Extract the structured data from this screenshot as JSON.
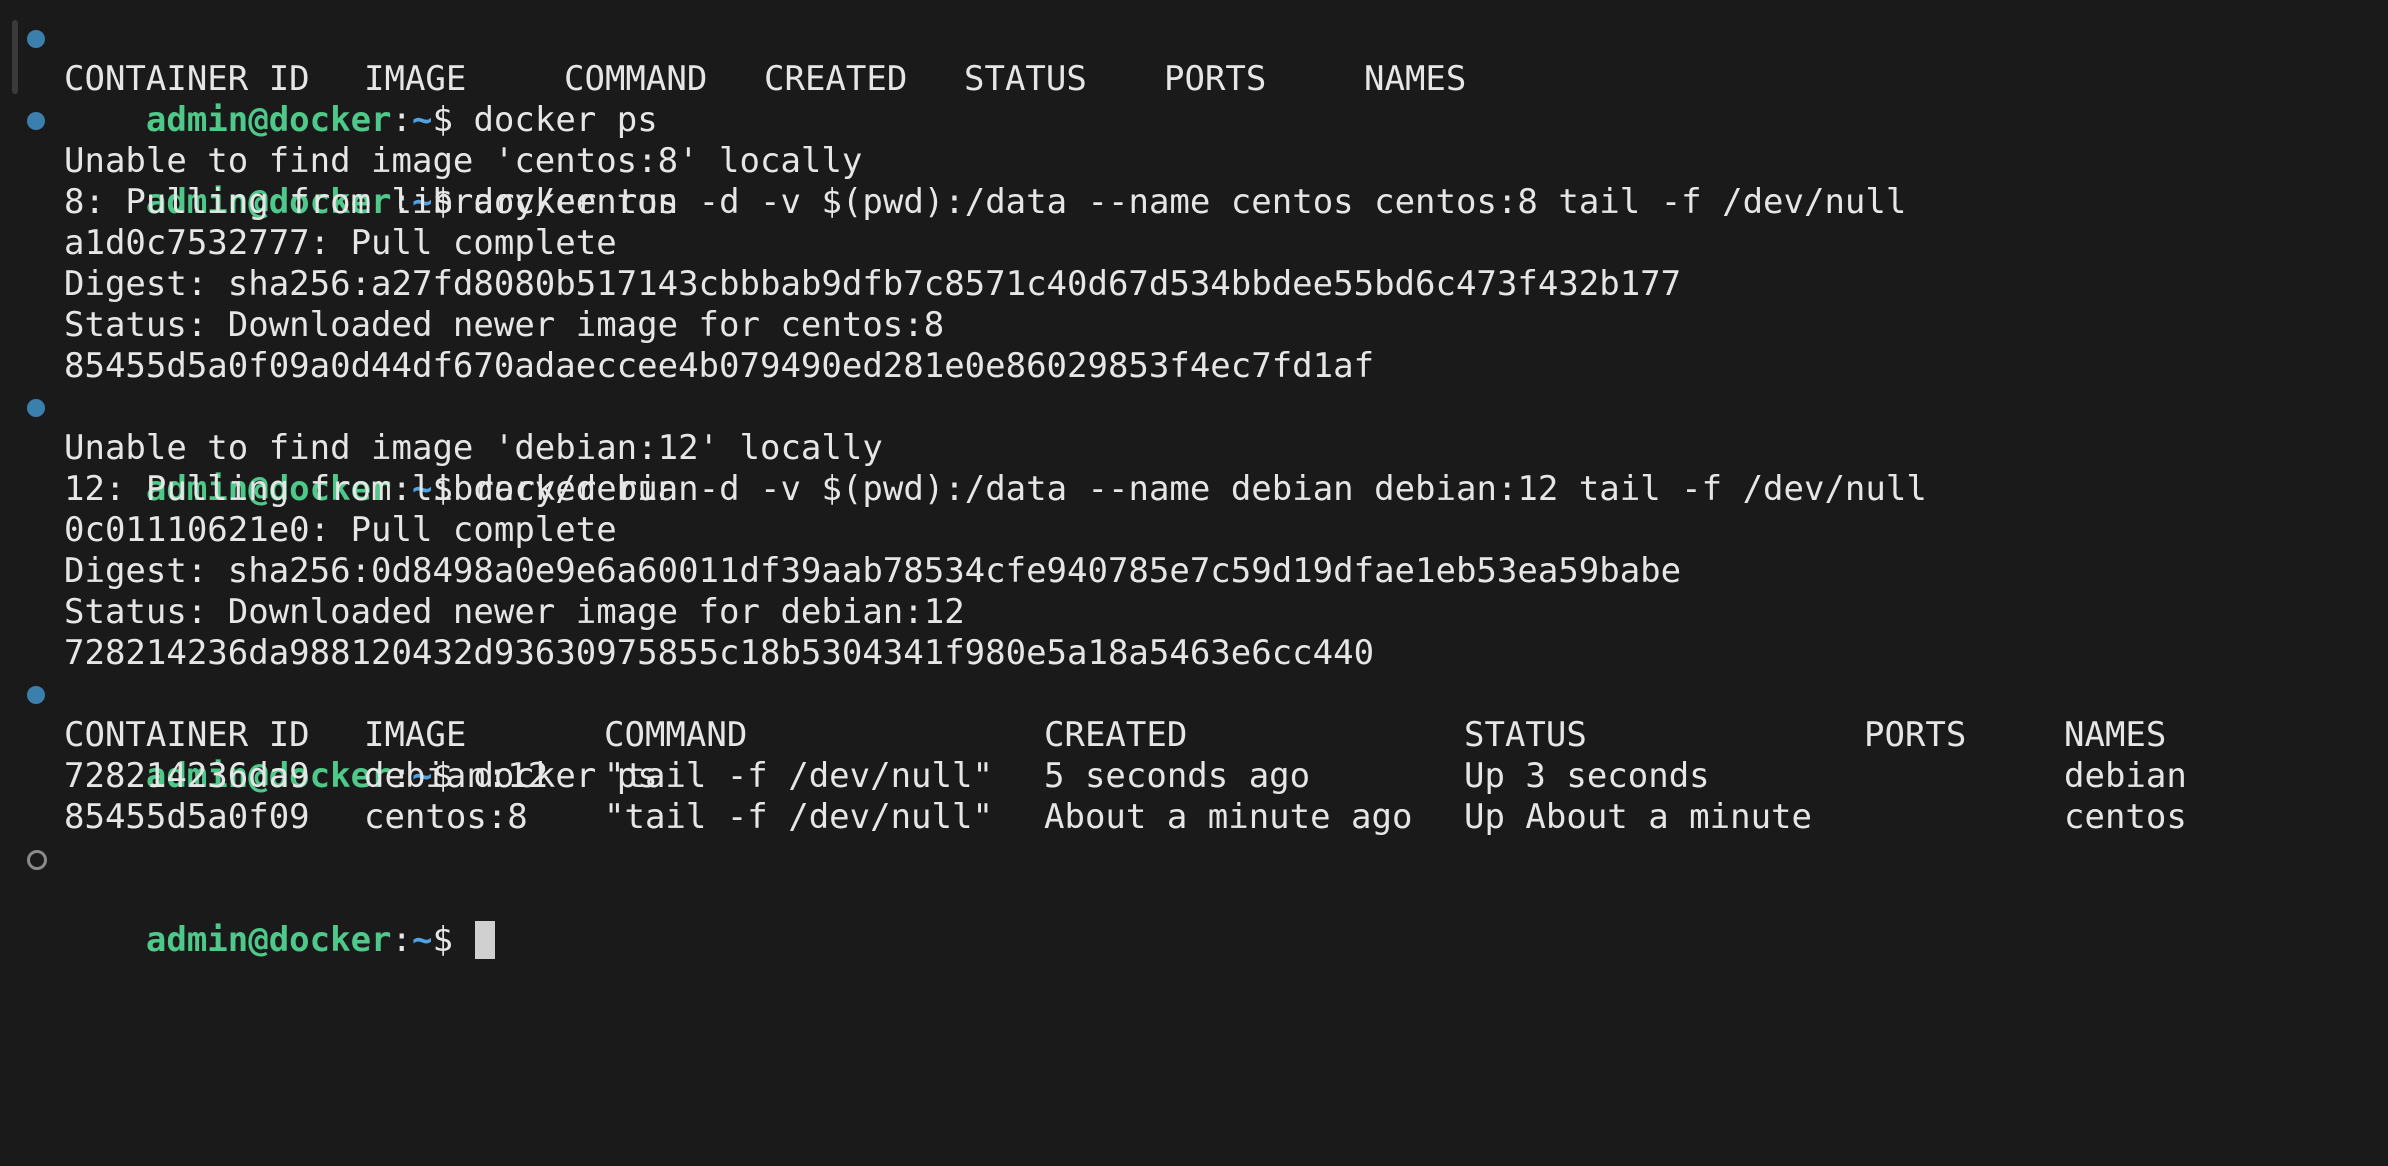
{
  "prompt": {
    "user_host": "admin@docker",
    "sep": ":",
    "path": "~",
    "symbol": "$ "
  },
  "commands": {
    "ps1": "docker ps",
    "run_centos": "docker run -d -v $(pwd):/data --name centos centos:8 tail -f /dev/null",
    "run_debian": "docker run -d -v $(pwd):/data --name debian debian:12 tail -f /dev/null",
    "ps2": "docker ps"
  },
  "ps1_header": {
    "container_id": "CONTAINER ID",
    "image": "IMAGE",
    "command": "COMMAND",
    "created": "CREATED",
    "status": "STATUS",
    "ports": "PORTS",
    "names": "NAMES"
  },
  "centos_output": [
    "Unable to find image 'centos:8' locally",
    "8: Pulling from library/centos",
    "a1d0c7532777: Pull complete",
    "Digest: sha256:a27fd8080b517143cbbbab9dfb7c8571c40d67d534bbdee55bd6c473f432b177",
    "Status: Downloaded newer image for centos:8",
    "85455d5a0f09a0d44df670adaeccee4b079490ed281e0e86029853f4ec7fd1af"
  ],
  "debian_output": [
    "Unable to find image 'debian:12' locally",
    "12: Pulling from library/debian",
    "0c01110621e0: Pull complete",
    "Digest: sha256:0d8498a0e9e6a60011df39aab78534cfe940785e7c59d19dfae1eb53ea59babe",
    "Status: Downloaded newer image for debian:12",
    "728214236da988120432d93630975855c18b5304341f980e5a18a5463e6cc440"
  ],
  "ps2_table": {
    "headers": [
      "CONTAINER ID",
      "IMAGE",
      "COMMAND",
      "CREATED",
      "STATUS",
      "PORTS",
      "NAMES"
    ],
    "rows": [
      [
        "728214236da9",
        "debian:12",
        "\"tail -f /dev/null\"",
        "5 seconds ago",
        "Up 3 seconds",
        "",
        "debian"
      ],
      [
        "85455d5a0f09",
        "centos:8",
        "\"tail -f /dev/null\"",
        "About a minute ago",
        "Up About a minute",
        "",
        "centos"
      ]
    ]
  },
  "colors": {
    "background": "#1a1a1a",
    "prompt_user": "#4ec98a",
    "prompt_path": "#4fa3e3",
    "marker": "#3b7fae",
    "text": "#e6e6e6"
  }
}
